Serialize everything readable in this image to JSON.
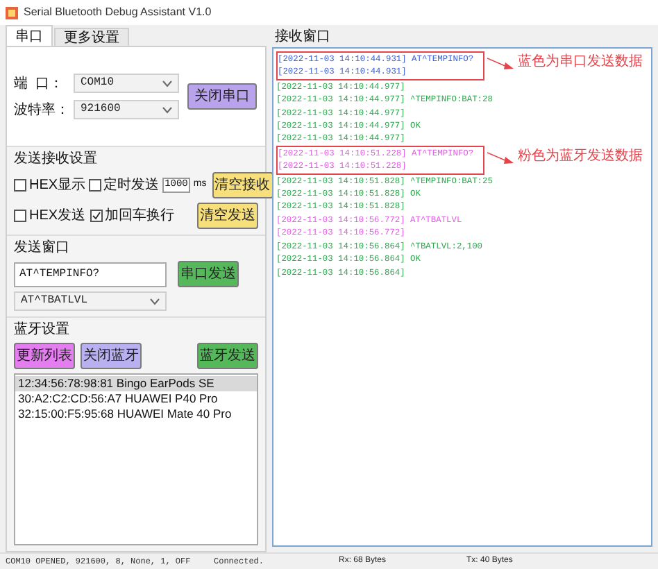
{
  "window": {
    "title": "Serial Bluetooth Debug Assistant V1.0"
  },
  "tabs": [
    {
      "label": "串口",
      "selected": true
    },
    {
      "label": "更多设置",
      "selected": false
    }
  ],
  "serial": {
    "port_label": "端  口：",
    "port": "COM10",
    "baud_label": "波特率：",
    "baud": "921600",
    "button": {
      "label": "关闭串口",
      "color": "#b9a3ec"
    }
  },
  "send_receive": {
    "title": "发送接收设置",
    "options": [
      {
        "label": "HEX显示",
        "checked": false
      },
      {
        "label": "定时发送",
        "checked": false
      },
      {
        "label": "HEX发送",
        "checked": false
      },
      {
        "label": "加回车换行",
        "checked": true
      }
    ],
    "interval": "1000",
    "unit": "ms",
    "buttons": [
      {
        "label": "清空接收",
        "color": "#f7df7c"
      },
      {
        "label": "清空发送",
        "color": "#f7df7c"
      }
    ]
  },
  "send_window": {
    "title": "发送窗口",
    "value": "AT^TEMPINFO?",
    "button": {
      "label": "串口发送",
      "color": "#55b85a"
    },
    "history": "AT^TBATLVL"
  },
  "bluetooth": {
    "title": "蓝牙设置",
    "buttons": [
      {
        "label": "更新列表",
        "color": "#e47ef0"
      },
      {
        "label": "关闭蓝牙",
        "color": "#b9b0f2"
      },
      {
        "label": "蓝牙发送",
        "color": "#55b85a"
      }
    ],
    "devices": [
      {
        "label": "12:34:56:78:98:81 Bingo EarPods SE",
        "selected": true
      },
      {
        "label": "30:A2:C2:CD:56:A7 HUAWEI P40 Pro",
        "selected": false
      },
      {
        "label": "32:15:00:F5:95:68 HUAWEI Mate 40 Pro",
        "selected": false
      }
    ]
  },
  "receive_window": {
    "title": "接收窗口",
    "blocks": [
      {
        "kind": "annotated",
        "note": "蓝色为串口发送数据",
        "lines": [
          {
            "time": "[2022-11-03 14:10:44.931]",
            "text": "AT^TEMPINFO?",
            "kind": "serial_tx"
          },
          {
            "time": "[2022-11-03 14:10:44.931]",
            "kind": "serial_tx"
          }
        ]
      },
      {
        "kind": "plain",
        "lines": [
          {
            "time": "[2022-11-03 14:10:44.977]",
            "kind": "rx"
          },
          {
            "time": "[2022-11-03 14:10:44.977]",
            "text": "^TEMPINFO:BAT:28",
            "kind": "rx"
          },
          {
            "time": "[2022-11-03 14:10:44.977]",
            "kind": "rx"
          },
          {
            "time": "[2022-11-03 14:10:44.977]",
            "text": "OK",
            "kind": "rx"
          },
          {
            "time": "[2022-11-03 14:10:44.977]",
            "kind": "rx"
          }
        ]
      },
      {
        "kind": "annotated",
        "note": "粉色为蓝牙发送数据",
        "lines": [
          {
            "time": "[2022-11-03 14:10:51.228]",
            "text": "AT^TEMPINFO?",
            "kind": "bt_tx"
          },
          {
            "time": "[2022-11-03 14:10:51.228]",
            "kind": "bt_tx"
          }
        ]
      },
      {
        "kind": "plain",
        "lines": [
          {
            "time": "[2022-11-03 14:10:51.828]",
            "text": "^TEMPINFO:BAT:25",
            "kind": "rx"
          },
          {
            "time": "[2022-11-03 14:10:51.828]",
            "text": "OK",
            "kind": "rx"
          },
          {
            "time": "[2022-11-03 14:10:51.828]",
            "kind": "rx"
          },
          {
            "time": "[2022-11-03 14:10:56.772]",
            "text": "AT^TBATLVL",
            "kind": "bt_tx"
          },
          {
            "time": "[2022-11-03 14:10:56.772]",
            "kind": "bt_tx"
          },
          {
            "time": "[2022-11-03 14:10:56.864]",
            "text": "^TBATLVL:2,100",
            "kind": "rx"
          },
          {
            "time": "[2022-11-03 14:10:56.864]",
            "text": "OK",
            "kind": "rx"
          },
          {
            "time": "[2022-11-03 14:10:56.864]",
            "kind": "rx"
          }
        ]
      }
    ]
  },
  "status_bar": {
    "port": "COM10 OPENED, 921600, 8, None, 1, OFF",
    "bluetooth": "Connected.",
    "rx": "Rx: 68 Bytes",
    "tx": "Tx: 40 Bytes"
  }
}
